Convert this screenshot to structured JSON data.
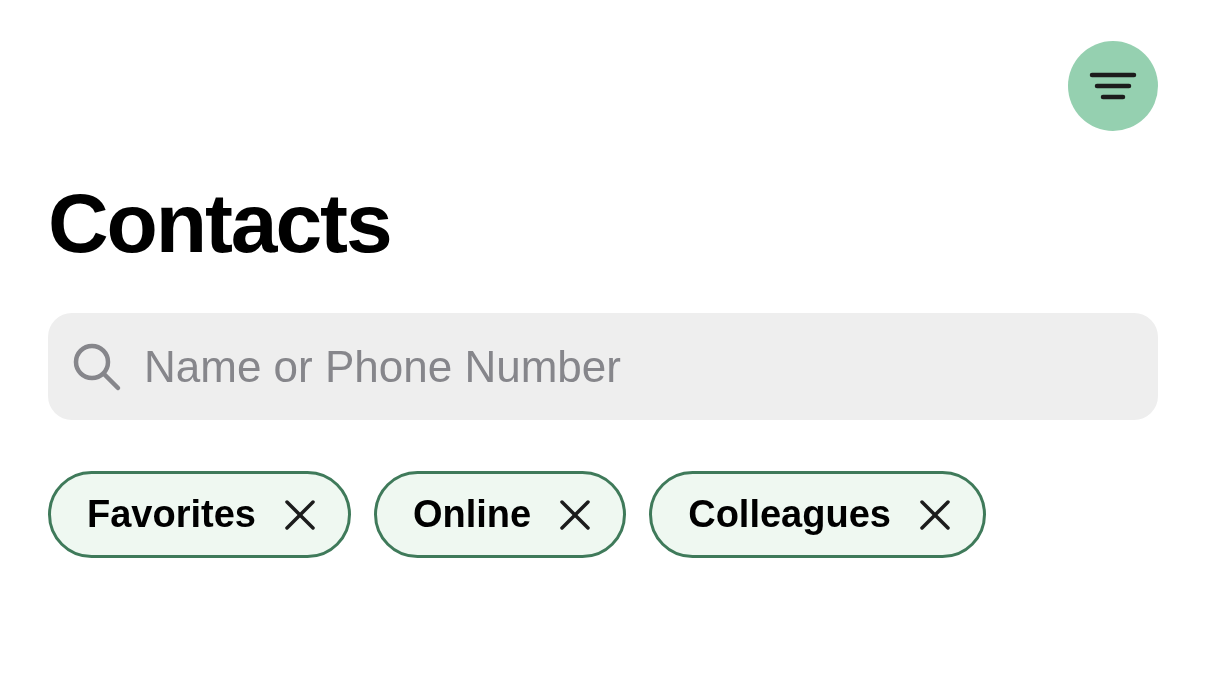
{
  "title": "Contacts",
  "search": {
    "placeholder": "Name or Phone Number"
  },
  "filters": [
    {
      "label": "Favorites"
    },
    {
      "label": "Online"
    },
    {
      "label": "Colleagues"
    }
  ]
}
